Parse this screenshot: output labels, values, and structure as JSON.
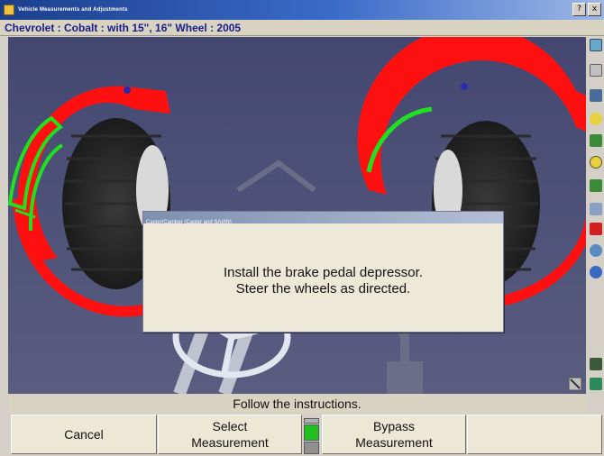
{
  "window": {
    "title": "Vehicle Measurements and Adjustments",
    "controls": [
      "?",
      "x"
    ]
  },
  "vehicle": {
    "description": "Chevrolet : Cobalt : with 15\", 16\" Wheel : 2005"
  },
  "dialog": {
    "title": "Caster/Camber (Caster and SAI/IN)",
    "message_line1": "Install the brake pedal depressor.",
    "message_line2": "Steer the wheels as directed."
  },
  "status": {
    "text": "Follow the instructions."
  },
  "function_keys": [
    {
      "label": "Cancel"
    },
    {
      "label": "Select\nMeasurement"
    },
    {
      "label": "Bypass\nMeasurement"
    },
    {
      "label": ""
    }
  ],
  "colors": {
    "viewport_bg": "#4a4d73",
    "gauge_red": "#ff1010",
    "gauge_green": "#20e020",
    "vehicle_text": "#1a1a8a"
  },
  "toolbar_icons": [
    "vehicle-select-icon",
    "specs-icon",
    "measure-icon",
    "caster-icon",
    "camber-icon",
    "steering-icon",
    "toe-icon",
    "adjust-icon",
    "print-icon",
    "zoom-icon",
    "help-icon",
    "tools-icon",
    "exit-icon"
  ]
}
